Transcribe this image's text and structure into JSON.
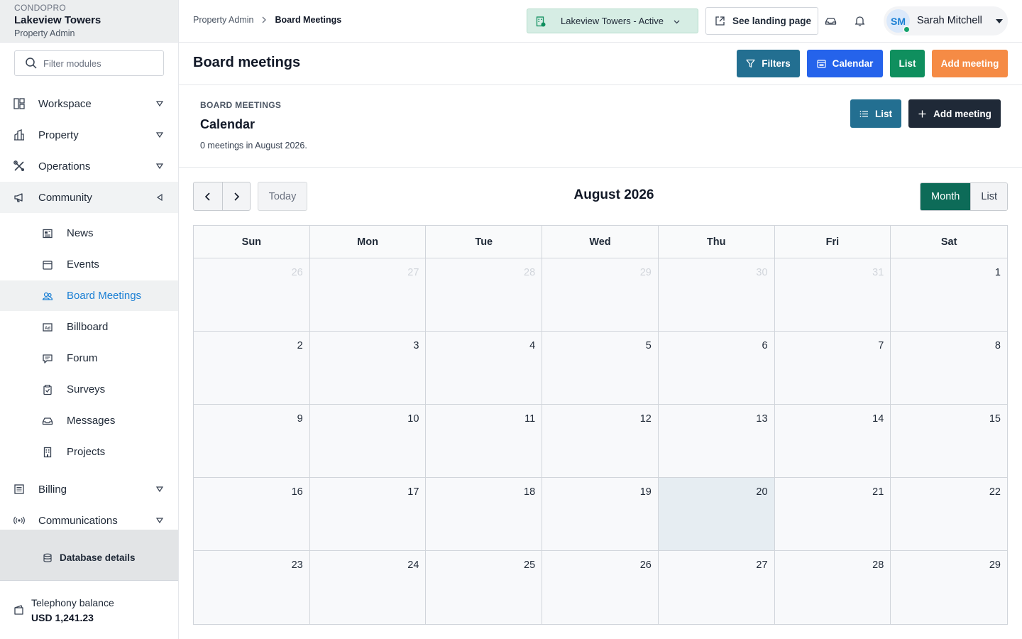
{
  "brand": {
    "org": "CONDOPRO",
    "name": "Lakeview Towers",
    "role": "Property Admin"
  },
  "sidebar": {
    "filter_placeholder": "Filter modules",
    "groups": {
      "workspace": "Workspace",
      "property": "Property",
      "operations": "Operations",
      "community": "Community",
      "billing": "Billing",
      "communications": "Communications"
    },
    "community_items": {
      "news": "News",
      "events": "Events",
      "board_meetings": "Board Meetings",
      "billboard": "Billboard",
      "forum": "Forum",
      "surveys": "Surveys",
      "messages": "Messages",
      "projects": "Projects"
    },
    "database_details": "Database details",
    "telephony": {
      "label": "Telephony balance",
      "value": "USD 1,241.23"
    }
  },
  "topbar": {
    "breadcrumb": [
      "Property Admin",
      "Board Meetings"
    ],
    "property_status": "Lakeview Towers - Active",
    "landing_label": "See landing page",
    "user": {
      "initials": "SM",
      "name": "Sarah Mitchell"
    }
  },
  "page": {
    "title": "Board meetings",
    "buttons": {
      "filters": "Filters",
      "calendar": "Calendar",
      "list": "List",
      "add": "Add meeting"
    }
  },
  "section": {
    "eyebrow": "BOARD MEETINGS",
    "title": "Calendar",
    "subtitle": "0 meetings in August 2026.",
    "list_button": "List",
    "add_button": "Add meeting"
  },
  "calendar": {
    "today_label": "Today",
    "month_title": "August 2026",
    "views": {
      "month": "Month",
      "list": "List"
    },
    "weekdays": [
      "Sun",
      "Mon",
      "Tue",
      "Wed",
      "Thu",
      "Fri",
      "Sat"
    ],
    "days": [
      {
        "n": "26",
        "out": true
      },
      {
        "n": "27",
        "out": true
      },
      {
        "n": "28",
        "out": true
      },
      {
        "n": "29",
        "out": true
      },
      {
        "n": "30",
        "out": true
      },
      {
        "n": "31",
        "out": true
      },
      {
        "n": "1"
      },
      {
        "n": "2"
      },
      {
        "n": "3"
      },
      {
        "n": "4"
      },
      {
        "n": "5"
      },
      {
        "n": "6"
      },
      {
        "n": "7"
      },
      {
        "n": "8"
      },
      {
        "n": "9"
      },
      {
        "n": "10"
      },
      {
        "n": "11"
      },
      {
        "n": "12"
      },
      {
        "n": "13"
      },
      {
        "n": "14"
      },
      {
        "n": "15"
      },
      {
        "n": "16"
      },
      {
        "n": "17"
      },
      {
        "n": "18"
      },
      {
        "n": "19"
      },
      {
        "n": "20",
        "today": true
      },
      {
        "n": "21"
      },
      {
        "n": "22"
      },
      {
        "n": "23"
      },
      {
        "n": "24"
      },
      {
        "n": "25"
      },
      {
        "n": "26"
      },
      {
        "n": "27"
      },
      {
        "n": "28"
      },
      {
        "n": "29"
      }
    ]
  },
  "colors": {
    "filters_btn": "#236f91",
    "calendar_btn": "#2563eb",
    "list_btn": "#0f8f5e",
    "add_btn": "#f58b45",
    "section_list_btn": "#236f91",
    "section_add_btn": "#1f2937",
    "active_link": "#1a7fd4",
    "month_toggle": "#0d6b58"
  }
}
